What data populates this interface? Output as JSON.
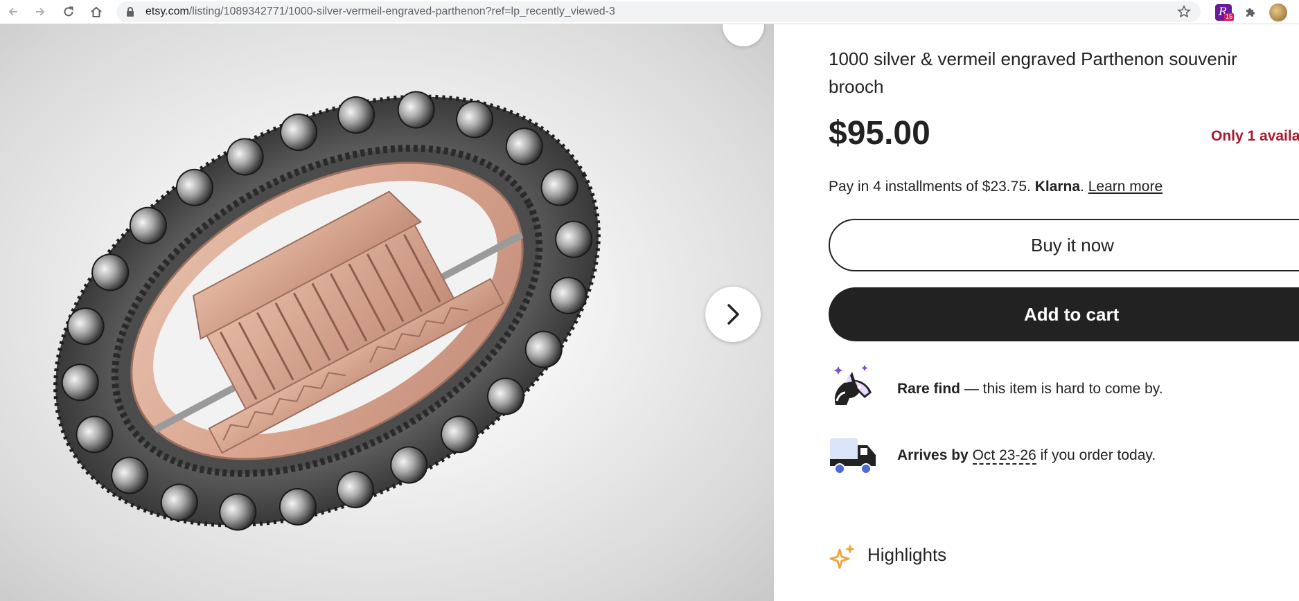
{
  "browser": {
    "url_host": "etsy.com",
    "url_path": "/listing/1089342771/1000-silver-vermeil-engraved-parthenon?ref=lp_recently_viewed-3",
    "extension_badge": "15"
  },
  "listing": {
    "title": "1000 silver & vermeil engraved Parthenon souvenir brooch",
    "price": "$95.00",
    "stock_note": "Only 1 availa",
    "installments": {
      "text": "Pay in 4 installments of $23.75.",
      "provider": "Klarna",
      "separator": ".",
      "learn_more": "Learn more"
    },
    "buy_now_label": "Buy it now",
    "add_to_cart_label": "Add to cart",
    "rare_find": {
      "bold": "Rare find",
      "rest": " — this item is hard to come by."
    },
    "arrival": {
      "bold": "Arrives by",
      "date": "Oct 23-26",
      "rest": " if you order today."
    },
    "highlights_heading": "Highlights"
  },
  "colors": {
    "stock_note": "#a61a2e",
    "button_dark": "#222222",
    "highlight_icon": "#f1a33c",
    "rare_icon_purple": "#7b4fd0",
    "truck_blue": "#4d6bd6"
  }
}
